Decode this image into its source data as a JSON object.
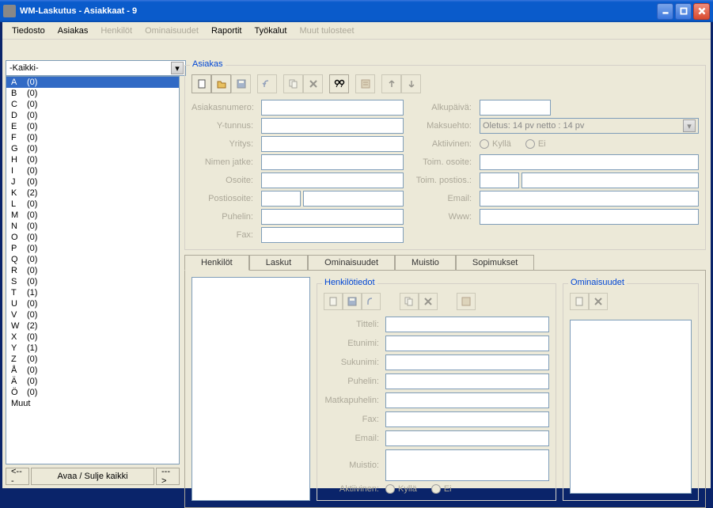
{
  "title": "WM-Laskutus - Asiakkaat - 9",
  "menu": {
    "tiedosto": "Tiedosto",
    "asiakas": "Asiakas",
    "henkilot": "Henkilöt",
    "ominaisuudet": "Ominaisuudet",
    "raportit": "Raportit",
    "tyokalut": "Työkalut",
    "muut": "Muut tulosteet"
  },
  "filter": {
    "value": "-Kaikki-"
  },
  "list": [
    {
      "l": "A",
      "c": "(0)"
    },
    {
      "l": "B",
      "c": "(0)"
    },
    {
      "l": "C",
      "c": "(0)"
    },
    {
      "l": "D",
      "c": "(0)"
    },
    {
      "l": "E",
      "c": "(0)"
    },
    {
      "l": "F",
      "c": "(0)"
    },
    {
      "l": "G",
      "c": "(0)"
    },
    {
      "l": "H",
      "c": "(0)"
    },
    {
      "l": "I",
      "c": "(0)"
    },
    {
      "l": "J",
      "c": "(0)"
    },
    {
      "l": "K",
      "c": "(2)"
    },
    {
      "l": "L",
      "c": "(0)"
    },
    {
      "l": "M",
      "c": "(0)"
    },
    {
      "l": "N",
      "c": "(0)"
    },
    {
      "l": "O",
      "c": "(0)"
    },
    {
      "l": "P",
      "c": "(0)"
    },
    {
      "l": "Q",
      "c": "(0)"
    },
    {
      "l": "R",
      "c": "(0)"
    },
    {
      "l": "S",
      "c": "(0)"
    },
    {
      "l": "T",
      "c": "(1)"
    },
    {
      "l": "U",
      "c": "(0)"
    },
    {
      "l": "V",
      "c": "(0)"
    },
    {
      "l": "W",
      "c": "(2)"
    },
    {
      "l": "X",
      "c": "(0)"
    },
    {
      "l": "Y",
      "c": "(1)"
    },
    {
      "l": "Z",
      "c": "(0)"
    },
    {
      "l": "Å",
      "c": "(0)"
    },
    {
      "l": "Ä",
      "c": "(0)"
    },
    {
      "l": "Ö",
      "c": "(0)"
    },
    {
      "l": "Muut",
      "c": ""
    }
  ],
  "bottom": {
    "prev": "<---",
    "open": "Avaa / Sulje kaikki",
    "next": "--->"
  },
  "group": {
    "asiakas": "Asiakas",
    "henkilotiedot": "Henkilötiedot",
    "ominaisuudet": "Ominaisuudet"
  },
  "labels": {
    "asiakasnumero": "Asiakasnumero:",
    "ytunnus": "Y-tunnus:",
    "yritys": "Yritys:",
    "nimenjatke": "Nimen jatke:",
    "osoite": "Osoite:",
    "postiosoite": "Postiosoite:",
    "puhelin": "Puhelin:",
    "fax": "Fax:",
    "alkupaiva": "Alkupäivä:",
    "maksuehto": "Maksuehto:",
    "aktiivinen": "Aktiivinen:",
    "toimosoite": "Toim. osoite:",
    "toimpostios": "Toim. postios.:",
    "email": "Email:",
    "www": "Www:",
    "titteli": "Titteli:",
    "etunimi": "Etunimi:",
    "sukunimi": "Sukunimi:",
    "matkapuhelin": "Matkapuhelin:",
    "muistio": "Muistio:",
    "kylla": "Kyllä",
    "ei": "Ei"
  },
  "maksuehto_value": "Oletus: 14 pv netto : 14 pv",
  "tabs": {
    "henkilot": "Henkilöt",
    "laskut": "Laskut",
    "ominaisuudet": "Ominaisuudet",
    "muistio": "Muistio",
    "sopimukset": "Sopimukset"
  }
}
